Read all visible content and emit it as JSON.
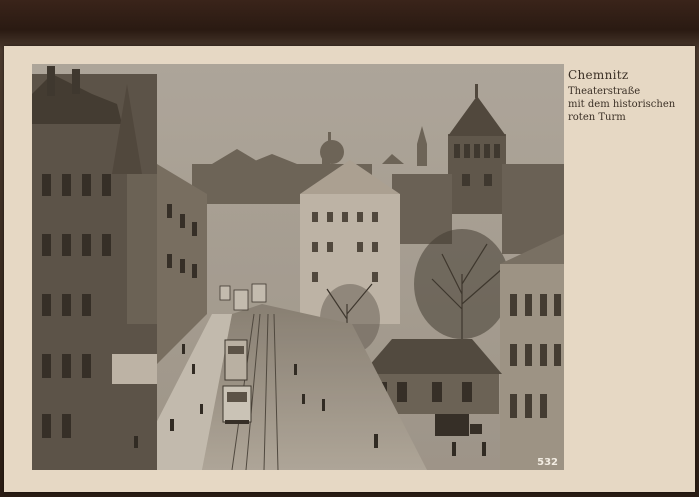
{
  "postcard": {
    "caption": {
      "title": "Chemnitz",
      "lines": [
        "Theaterstraße",
        "mit dem historischen",
        "roten Turm"
      ]
    },
    "photo_number": "532"
  },
  "colors": {
    "card": "#e6d8c4",
    "caption_text": "#3b3026",
    "backdrop": "#2a1d14"
  }
}
